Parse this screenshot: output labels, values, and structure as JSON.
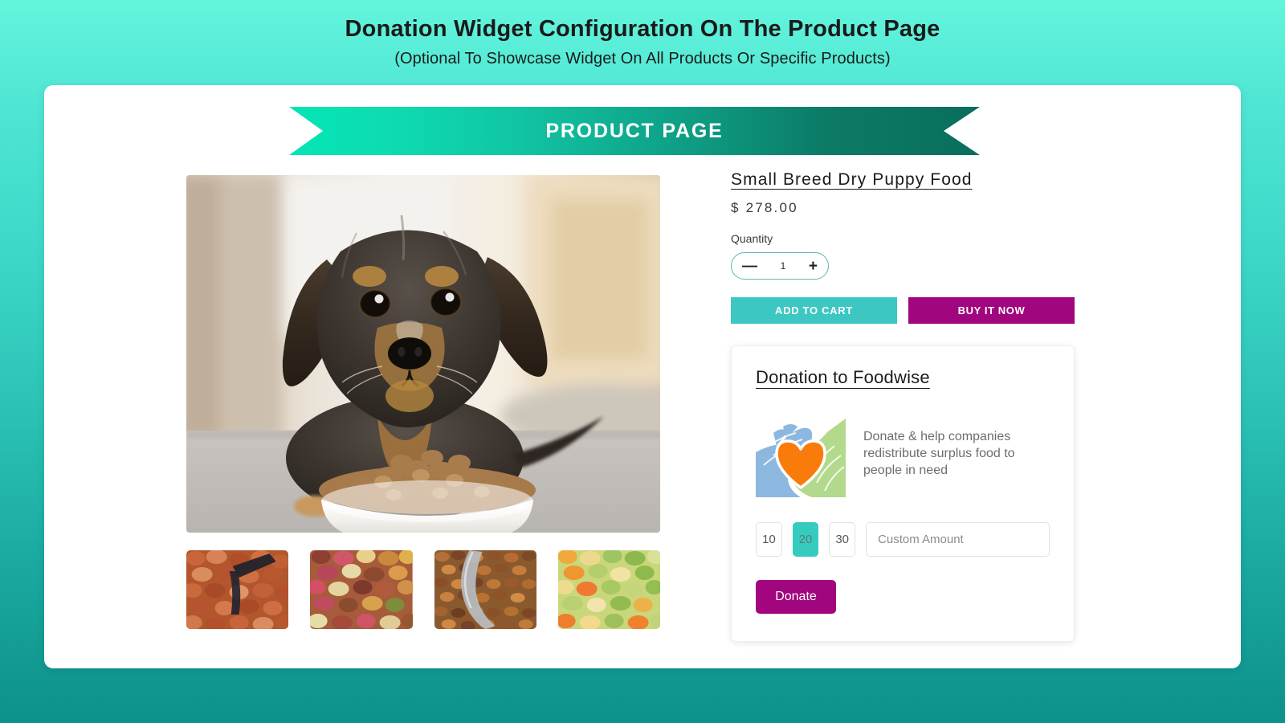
{
  "header": {
    "title": "Donation Widget Configuration On The Product Page",
    "subtitle": "(Optional To Showcase Widget On All Products Or Specific Products)"
  },
  "ribbon": {
    "label": "PRODUCT PAGE"
  },
  "gallery": {
    "hero_alt": "dachshund-puppy-with-bowl-of-kibble",
    "thumbnails": [
      {
        "alt": "red-brown-kibble-with-scoop"
      },
      {
        "alt": "multicolor-mixed-kibble"
      },
      {
        "alt": "orange-brown-kibble-with-spoon"
      },
      {
        "alt": "green-orange-yellow-kibble"
      }
    ]
  },
  "product": {
    "title": "Small Breed Dry Puppy Food",
    "price": "$ 278.00",
    "quantity_label": "Quantity",
    "quantity_value": "1",
    "decrement_label": "—",
    "increment_label": "+",
    "add_to_cart_label": "ADD TO CART",
    "buy_now_label": "BUY IT NOW"
  },
  "donation": {
    "heading": "Donation to Foodwise",
    "description": "Donate & help companies redistribute surplus food to people in need",
    "logo_alt": "hands-holding-heart-logo",
    "amounts": [
      {
        "label": "10",
        "selected": false
      },
      {
        "label": "20",
        "selected": true
      },
      {
        "label": "30",
        "selected": false
      }
    ],
    "custom_amount_placeholder": "Custom Amount",
    "custom_amount_value": "",
    "donate_label": "Donate"
  },
  "colors": {
    "background_top": "#63f5dd",
    "background_bottom": "#0d918a",
    "ribbon_start": "#04e5b4",
    "ribbon_end": "#0a6e5d",
    "teal_accent": "#3cc7c3",
    "magenta_accent": "#a1067f",
    "selected_amount": "#35ccbf",
    "heart_orange": "#f97c0b",
    "hand_blue": "#8cb8e0",
    "hand_green": "#b2d98c"
  }
}
